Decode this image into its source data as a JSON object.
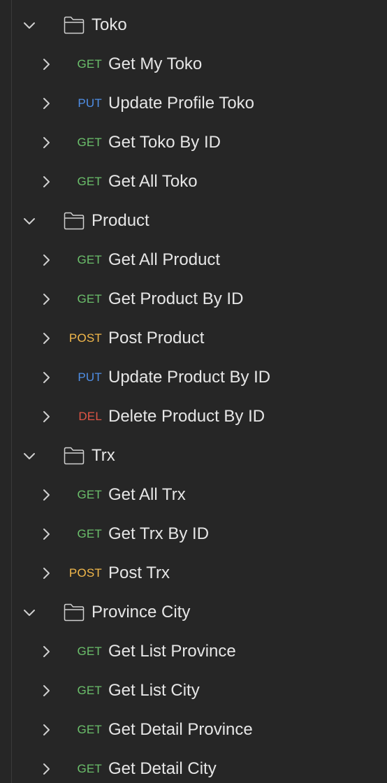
{
  "colors": {
    "background": "#262626",
    "text": "#e6e6e6",
    "icon": "#d0d0d0",
    "GET": "#6bbf6b",
    "PUT": "#4f8fe6",
    "POST": "#f2b84b",
    "DEL": "#e05545"
  },
  "icons": {
    "expanded": "chevron-down-icon",
    "collapsed": "chevron-right-icon",
    "folder": "folder-icon"
  },
  "folders": [
    {
      "name": "Toko",
      "requests": [
        {
          "method": "GET",
          "name": "Get My Toko"
        },
        {
          "method": "PUT",
          "name": "Update Profile Toko"
        },
        {
          "method": "GET",
          "name": "Get Toko By ID"
        },
        {
          "method": "GET",
          "name": "Get All Toko"
        }
      ]
    },
    {
      "name": "Product",
      "requests": [
        {
          "method": "GET",
          "name": "Get All Product"
        },
        {
          "method": "GET",
          "name": "Get Product By ID"
        },
        {
          "method": "POST",
          "name": "Post Product"
        },
        {
          "method": "PUT",
          "name": "Update Product By ID"
        },
        {
          "method": "DEL",
          "name": "Delete Product By ID"
        }
      ]
    },
    {
      "name": "Trx",
      "requests": [
        {
          "method": "GET",
          "name": "Get All Trx"
        },
        {
          "method": "GET",
          "name": "Get Trx By ID"
        },
        {
          "method": "POST",
          "name": "Post Trx"
        }
      ]
    },
    {
      "name": "Province City",
      "requests": [
        {
          "method": "GET",
          "name": "Get List Province"
        },
        {
          "method": "GET",
          "name": "Get List City"
        },
        {
          "method": "GET",
          "name": "Get Detail Province"
        },
        {
          "method": "GET",
          "name": "Get Detail City"
        }
      ]
    }
  ]
}
